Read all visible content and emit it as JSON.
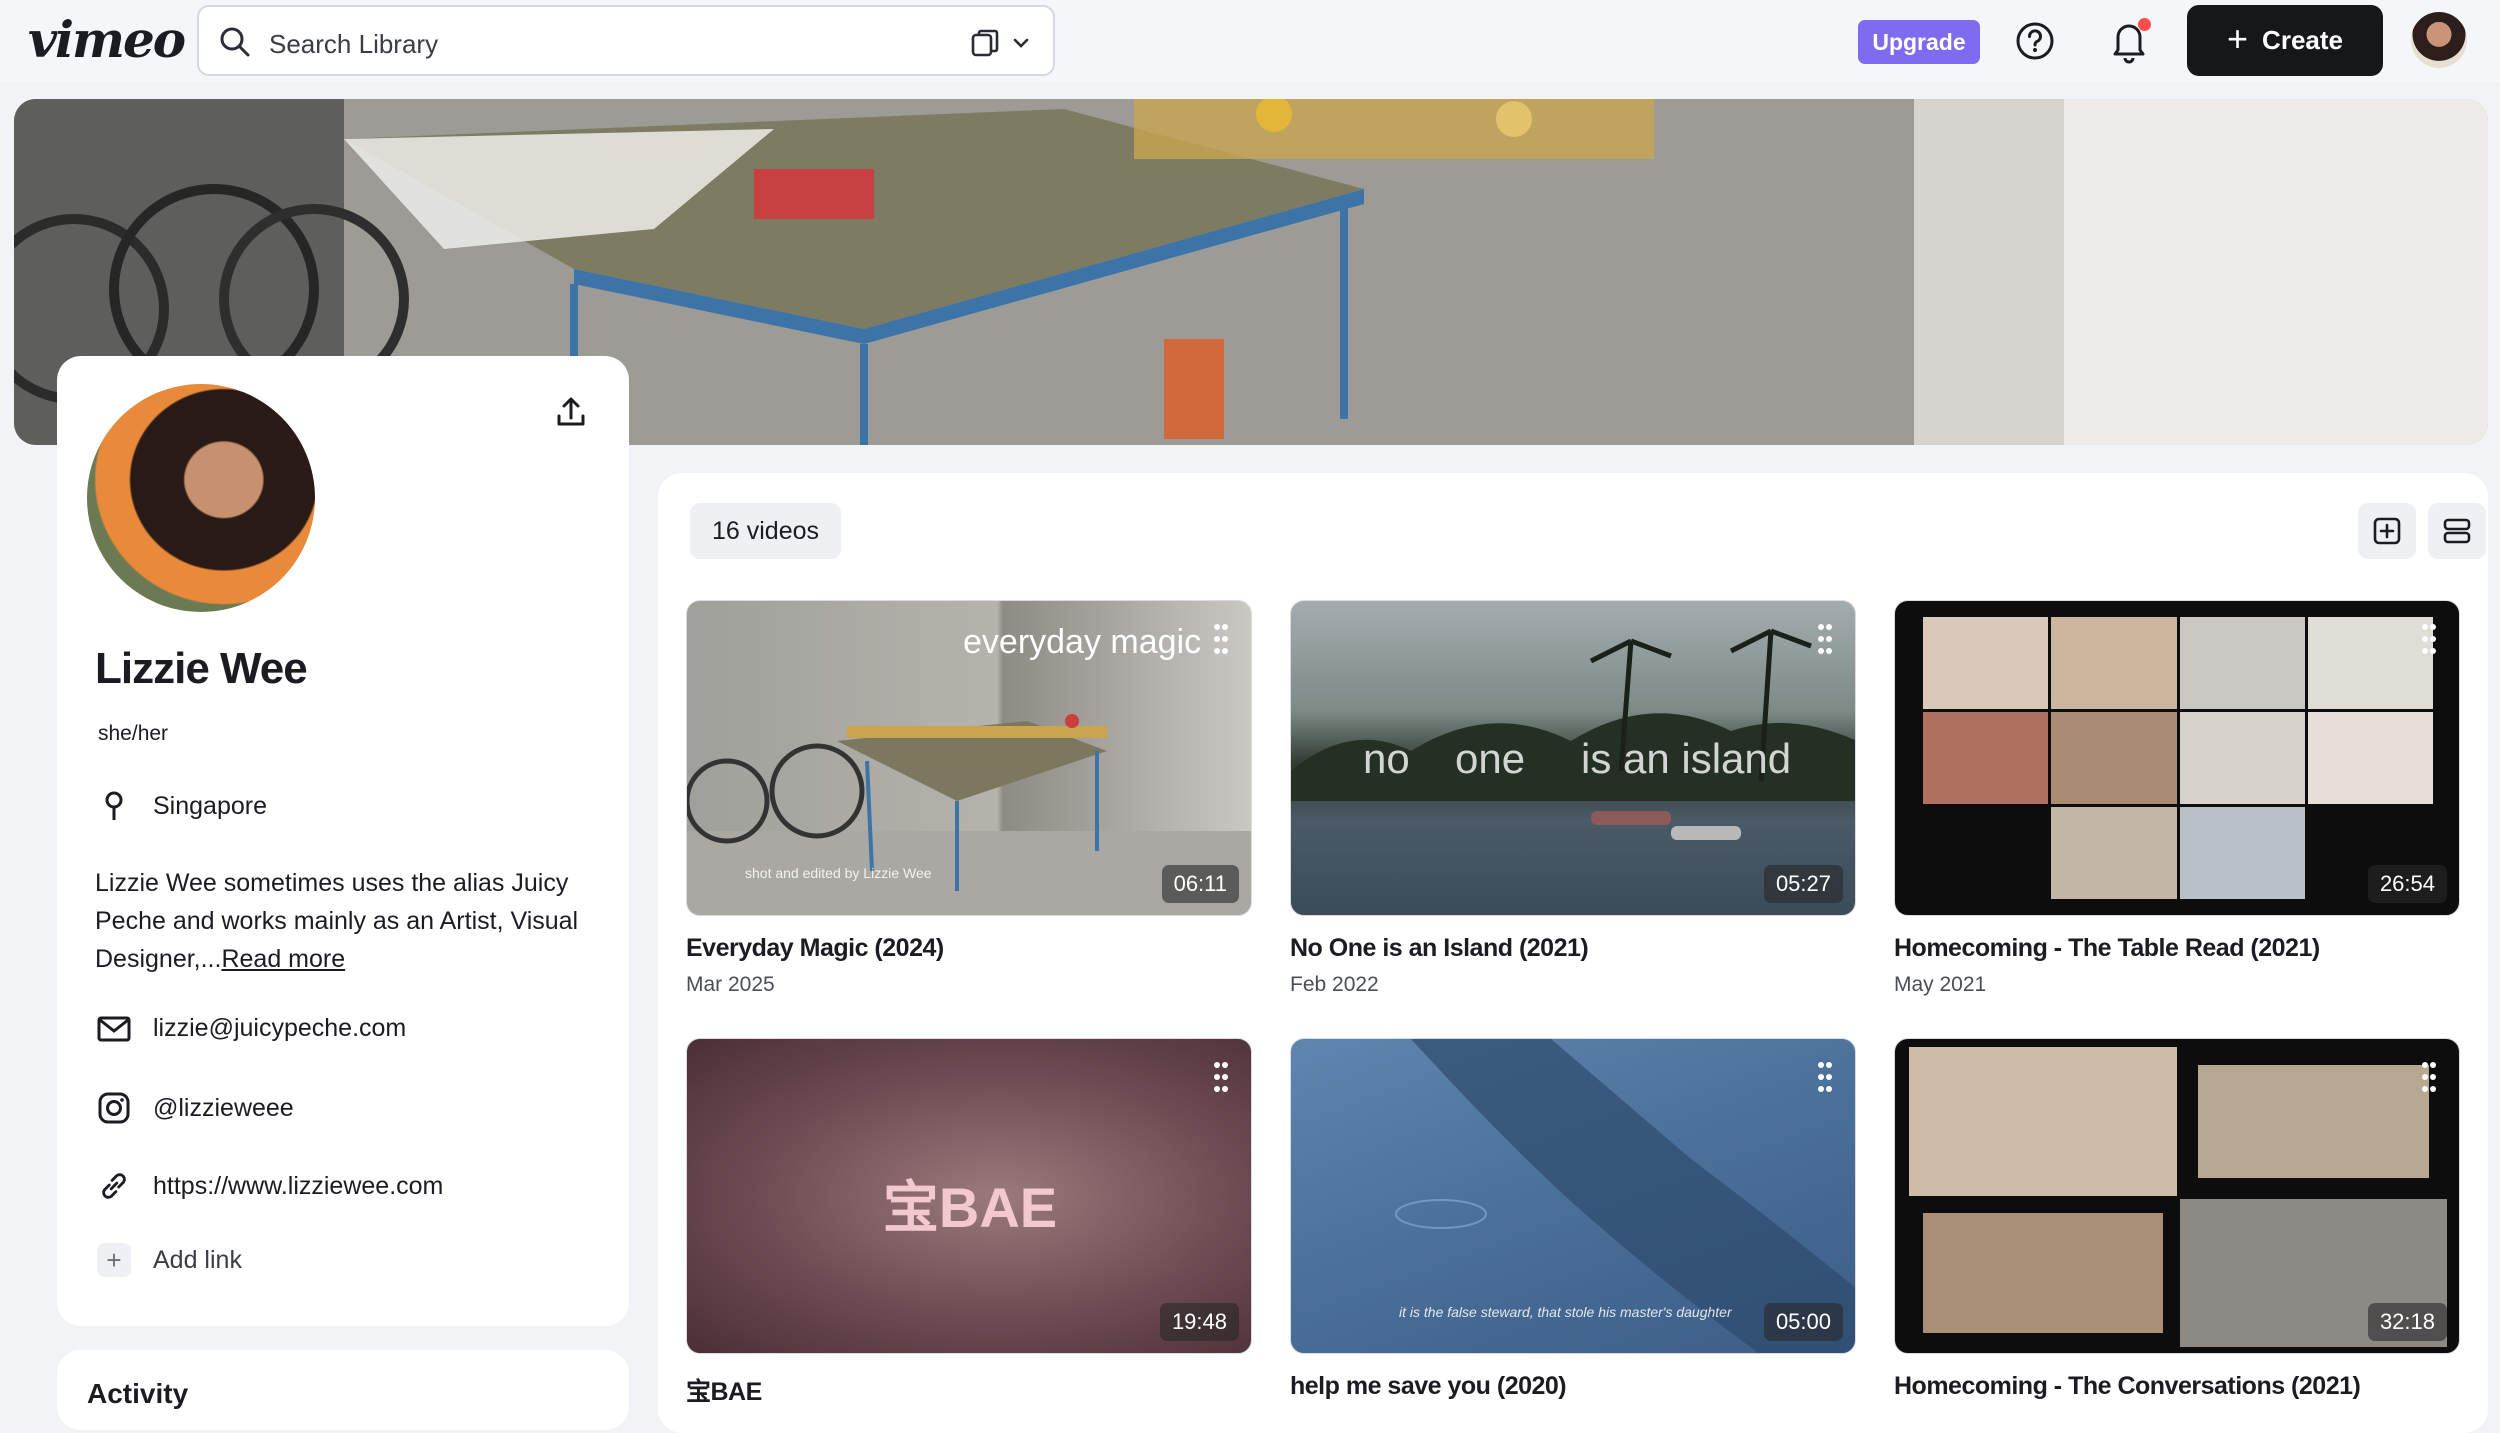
{
  "topbar": {
    "logo": "vimeo",
    "search_placeholder": "Search Library",
    "upgrade_label": "Upgrade",
    "create_label": "Create"
  },
  "profile": {
    "name": "Lizzie Wee",
    "pronouns": "she/her",
    "location": "Singapore",
    "bio": "Lizzie Wee sometimes uses the alias Juicy Peche and works mainly as an Artist, Visual Designer,...",
    "read_more": "Read more",
    "email": "lizzie@juicypeche.com",
    "instagram": "@lizzieweee",
    "website": "https://www.lizziewee.com",
    "add_link": "Add link"
  },
  "activity": {
    "title": "Activity"
  },
  "videos": {
    "count_label": "16 videos",
    "items": [
      {
        "title": "Everyday Magic (2024)",
        "date": "Mar 2025",
        "duration": "06:11",
        "overlay": "everyday magic",
        "caption": "shot and edited by Lizzie Wee"
      },
      {
        "title": "No One is an Island (2021)",
        "date": "Feb 2022",
        "duration": "05:27",
        "overlay_words": [
          "no",
          "one",
          "is an island"
        ]
      },
      {
        "title": "Homecoming - The Table Read (2021)",
        "date": "May 2021",
        "duration": "26:54"
      },
      {
        "title": "宝BAE",
        "duration": "19:48",
        "overlay": "宝BAE"
      },
      {
        "title": "help me save you (2020)",
        "duration": "05:00",
        "caption": "it is the false steward, that stole his master's daughter"
      },
      {
        "title": "Homecoming - The Conversations (2021)",
        "duration": "32:18"
      }
    ]
  },
  "colors": {
    "accent_upgrade": "#7f6bf0",
    "create_bg": "#15171b",
    "notification_dot": "#ff4d4d"
  },
  "icons": [
    "search-icon",
    "copy-icon",
    "chevron-down-icon",
    "help-icon",
    "bell-icon",
    "plus-icon",
    "share-icon",
    "location-pin-icon",
    "mail-icon",
    "instagram-icon",
    "link-icon",
    "add-folder-icon",
    "layout-toggle-icon",
    "drag-dots-icon"
  ]
}
